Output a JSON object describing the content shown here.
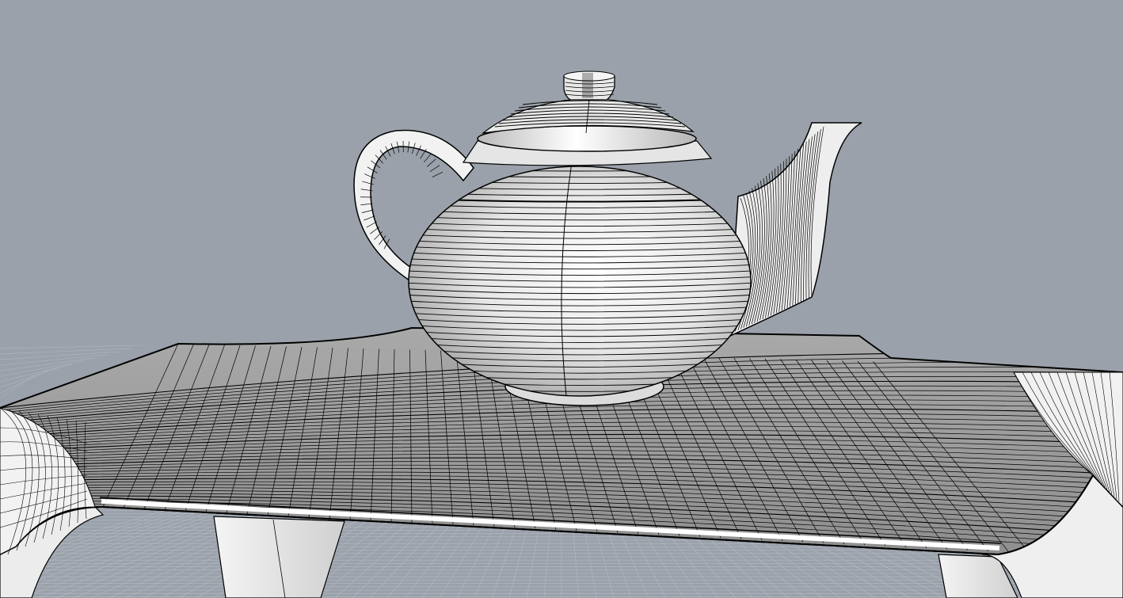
{
  "viewport": {
    "display_mode": "shaded-with-isocurves",
    "background_color": "#9aa1aa",
    "surface_color": "#ffffff",
    "shadow_color": "#8d8d8d",
    "wire_color": "#000000",
    "grid_color": "#b3bac2"
  },
  "scene_objects": [
    {
      "name": "teapot",
      "type": "surface"
    },
    {
      "name": "bench-table",
      "type": "surface"
    },
    {
      "name": "construction-grid",
      "type": "grid"
    }
  ]
}
